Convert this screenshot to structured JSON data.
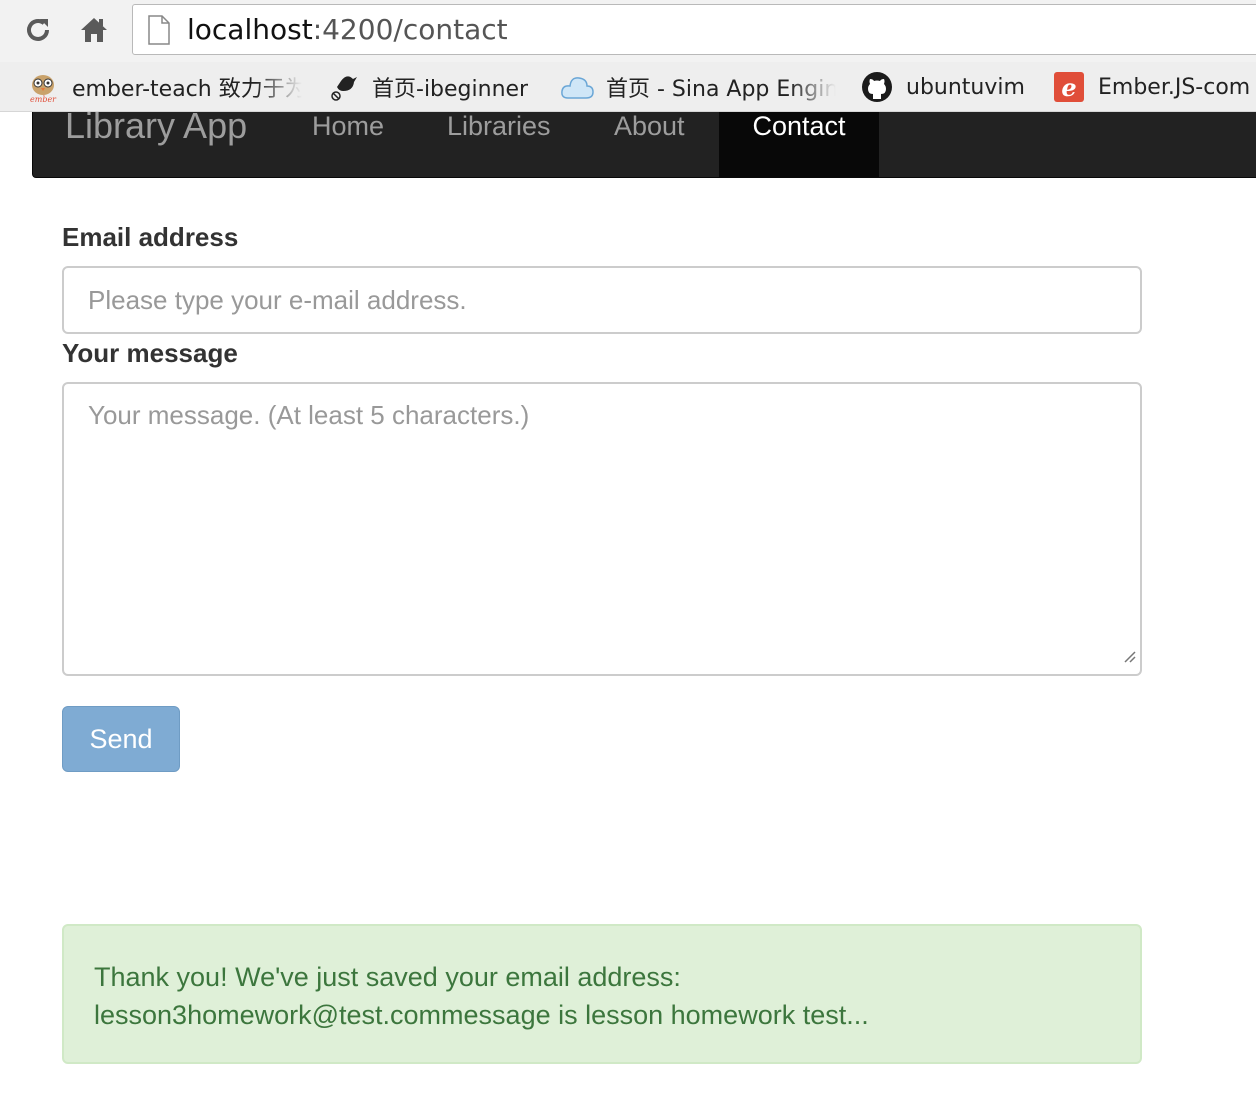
{
  "browser": {
    "url_host": "localhost",
    "url_rest": ":4200/contact",
    "bookmarks": [
      {
        "label": "ember-teach  致力于为",
        "icon": "ember-owl-icon"
      },
      {
        "label": "首页-ibeginner",
        "icon": "bird-icon"
      },
      {
        "label": "首页 - Sina App Engine",
        "icon": "cloud-icon"
      },
      {
        "label": "ubuntuvim",
        "icon": "github-icon"
      },
      {
        "label": "Ember.JS-com",
        "icon": "ember-e-icon"
      }
    ]
  },
  "navbar": {
    "brand": "Library App",
    "links": [
      "Home",
      "Libraries",
      "About",
      "Contact"
    ],
    "active": "Contact"
  },
  "form": {
    "email_label": "Email address",
    "email_placeholder": "Please type your e-mail address.",
    "message_label": "Your message",
    "message_placeholder": "Your message. (At least 5 characters.)",
    "send_label": "Send"
  },
  "alert": {
    "line1": "Thank you! We've just saved your email address:",
    "line2": "lesson3homework@test.commessage is lesson homework test..."
  },
  "colors": {
    "navbar_bg": "#222222",
    "button_disabled": "#7fabd3",
    "alert_bg": "#dff0d8",
    "alert_text": "#3c763d"
  }
}
